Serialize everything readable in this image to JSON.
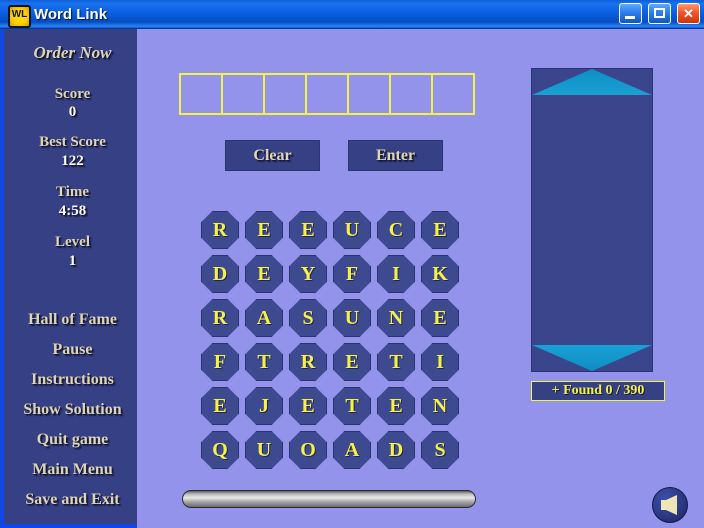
{
  "window": {
    "title": "Word Link",
    "icon": "wl-app-icon",
    "icon_text": "WL",
    "buttons": {
      "minimize": "minimize-icon",
      "maximize": "maximize-icon",
      "close": "close-icon",
      "close_glyph": "✕"
    }
  },
  "sidebar": {
    "order_now": "Order Now",
    "stats": [
      {
        "label": "Score",
        "value": "0"
      },
      {
        "label": "Best Score",
        "value": "122"
      },
      {
        "label": "Time",
        "value": "4:58"
      },
      {
        "label": "Level",
        "value": "1"
      }
    ],
    "menu": [
      "Hall of Fame",
      "Pause",
      "Instructions",
      "Show Solution",
      "Quit game",
      "Main Menu",
      "Save and Exit"
    ]
  },
  "main": {
    "word_slots": [
      "",
      "",
      "",
      "",
      "",
      "",
      ""
    ],
    "buttons": {
      "clear": "Clear",
      "enter": "Enter"
    },
    "grid": {
      "rows": [
        [
          "R",
          "E",
          "E",
          "U",
          "C",
          "E"
        ],
        [
          "D",
          "E",
          "Y",
          "F",
          "I",
          "K"
        ],
        [
          "R",
          "A",
          "S",
          "U",
          "N",
          "E"
        ],
        [
          "F",
          "T",
          "R",
          "E",
          "T",
          "I"
        ],
        [
          "E",
          "J",
          "E",
          "T",
          "E",
          "N"
        ],
        [
          "Q",
          "U",
          "O",
          "A",
          "D",
          "S"
        ]
      ]
    },
    "word_panel": {
      "scroll_up": "scroll-up-arrow",
      "scroll_down": "scroll-down-arrow",
      "found_words": []
    },
    "found_counter": "+ Found 0 / 390",
    "timer_bar": "timer-progress-bar",
    "sound_toggle": "speaker-icon"
  },
  "colors": {
    "background": "#9393ec",
    "sidebar": "#364084",
    "tile": "#3e4a90",
    "letter": "#f5f04a",
    "accent_border": "#1048e8",
    "arrow": "#1aa0d2",
    "titlebar": "#0a60e0"
  }
}
